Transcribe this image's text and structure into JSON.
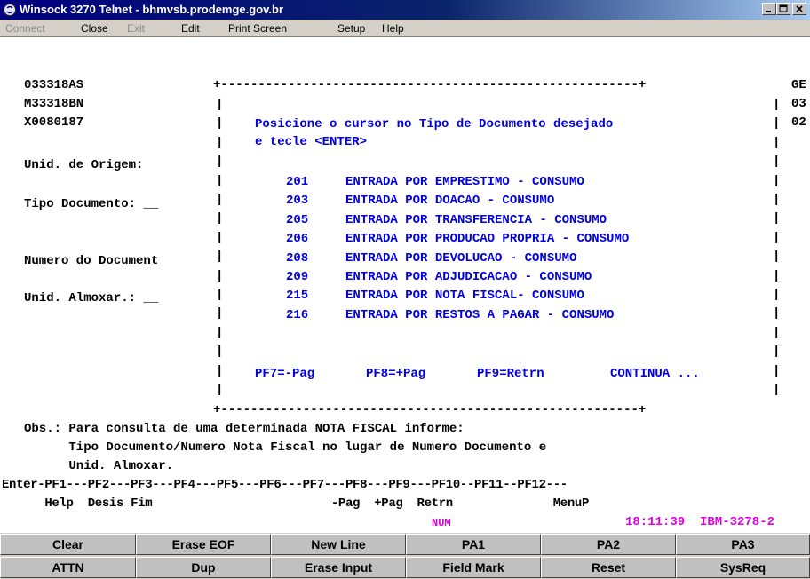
{
  "window": {
    "title": "Winsock 3270 Telnet - bhmvsb.prodemge.gov.br"
  },
  "menu": [
    {
      "label": "Connect",
      "enabled": false
    },
    {
      "label": "Close",
      "enabled": true
    },
    {
      "label": "Exit",
      "enabled": false
    },
    {
      "label": "Edit",
      "enabled": true
    },
    {
      "label": "Print Screen",
      "enabled": true
    },
    {
      "label": "Setup",
      "enabled": true
    },
    {
      "label": "Help",
      "enabled": true
    }
  ],
  "screen": {
    "header_left": [
      "033318AS",
      "M33318BN",
      "X0080187"
    ],
    "header_right": [
      "GE",
      "03",
      "02"
    ],
    "labels": {
      "origem": "Unid. de Origem:",
      "tipo": "Tipo Documento: __",
      "numero": "Numero do Document",
      "almox": "Unid. Almoxar.: __"
    },
    "popup": {
      "border_top": "+--------------------------------------------------------+",
      "border_bottom": "+--------------------------------------------------------+",
      "border_side": "|",
      "instruction_1": "Posicione o cursor no Tipo de Documento desejado",
      "instruction_2": "e tecle <ENTER>",
      "items": [
        {
          "code": "201",
          "desc": "ENTRADA POR EMPRESTIMO - CONSUMO"
        },
        {
          "code": "203",
          "desc": "ENTRADA POR DOACAO - CONSUMO"
        },
        {
          "code": "205",
          "desc": "ENTRADA POR TRANSFERENCIA - CONSUMO"
        },
        {
          "code": "206",
          "desc": "ENTRADA POR PRODUCAO PROPRIA - CONSUMO"
        },
        {
          "code": "208",
          "desc": "ENTRADA POR DEVOLUCAO - CONSUMO"
        },
        {
          "code": "209",
          "desc": "ENTRADA POR ADJUDICACAO - CONSUMO"
        },
        {
          "code": "215",
          "desc": "ENTRADA POR NOTA FISCAL- CONSUMO"
        },
        {
          "code": "216",
          "desc": "ENTRADA POR RESTOS A PAGAR - CONSUMO"
        }
      ],
      "pf7": "PF7=-Pag",
      "pf8": "PF8=+Pag",
      "pf9": "PF9=Retrn",
      "continua": "CONTINUA ..."
    },
    "obs": [
      "Obs.: Para consulta de uma determinada NOTA FISCAL informe:",
      "      Tipo Documento/Numero Nota Fiscal no lugar de Numero Documento e",
      "      Unid. Almoxar."
    ],
    "pf_line": "Enter-PF1---PF2---PF3---PF4---PF5---PF6---PF7---PF8---PF9---PF10--PF11--PF12---",
    "pf_labels": "      Help  Desis Fim                         -Pag  +Pag  Retrn              MenuP",
    "status": {
      "num": "NUM",
      "time": "18:11:39",
      "term": "IBM-3278-2"
    }
  },
  "keypad": {
    "row1": [
      "Clear",
      "Erase EOF",
      "New Line",
      "PA1",
      "PA2",
      "PA3"
    ],
    "row2": [
      "ATTN",
      "Dup",
      "Erase Input",
      "Field Mark",
      "Reset",
      "SysReq"
    ]
  },
  "colors": {
    "popup_text": "#0000e0",
    "status_text": "#e000e0",
    "title_bar": "#000080"
  }
}
